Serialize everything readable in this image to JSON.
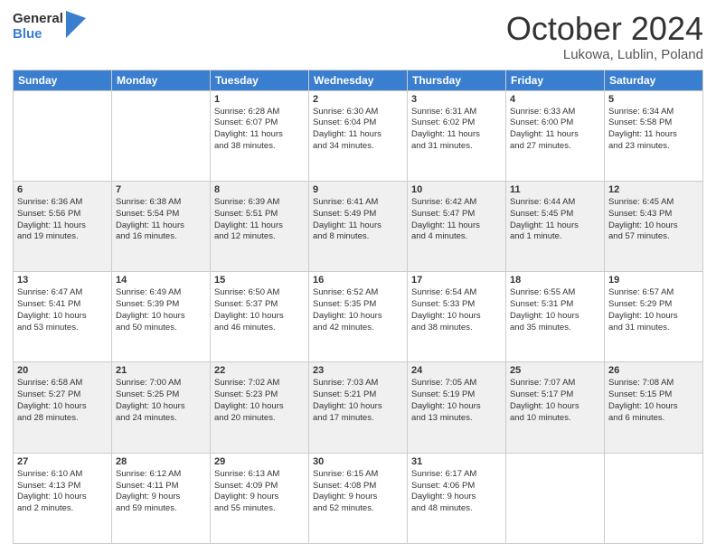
{
  "logo": {
    "general": "General",
    "blue": "Blue"
  },
  "title": "October 2024",
  "subtitle": "Lukowa, Lublin, Poland",
  "days_of_week": [
    "Sunday",
    "Monday",
    "Tuesday",
    "Wednesday",
    "Thursday",
    "Friday",
    "Saturday"
  ],
  "weeks": [
    [
      {
        "day": "",
        "lines": []
      },
      {
        "day": "",
        "lines": []
      },
      {
        "day": "1",
        "lines": [
          "Sunrise: 6:28 AM",
          "Sunset: 6:07 PM",
          "Daylight: 11 hours",
          "and 38 minutes."
        ]
      },
      {
        "day": "2",
        "lines": [
          "Sunrise: 6:30 AM",
          "Sunset: 6:04 PM",
          "Daylight: 11 hours",
          "and 34 minutes."
        ]
      },
      {
        "day": "3",
        "lines": [
          "Sunrise: 6:31 AM",
          "Sunset: 6:02 PM",
          "Daylight: 11 hours",
          "and 31 minutes."
        ]
      },
      {
        "day": "4",
        "lines": [
          "Sunrise: 6:33 AM",
          "Sunset: 6:00 PM",
          "Daylight: 11 hours",
          "and 27 minutes."
        ]
      },
      {
        "day": "5",
        "lines": [
          "Sunrise: 6:34 AM",
          "Sunset: 5:58 PM",
          "Daylight: 11 hours",
          "and 23 minutes."
        ]
      }
    ],
    [
      {
        "day": "6",
        "lines": [
          "Sunrise: 6:36 AM",
          "Sunset: 5:56 PM",
          "Daylight: 11 hours",
          "and 19 minutes."
        ]
      },
      {
        "day": "7",
        "lines": [
          "Sunrise: 6:38 AM",
          "Sunset: 5:54 PM",
          "Daylight: 11 hours",
          "and 16 minutes."
        ]
      },
      {
        "day": "8",
        "lines": [
          "Sunrise: 6:39 AM",
          "Sunset: 5:51 PM",
          "Daylight: 11 hours",
          "and 12 minutes."
        ]
      },
      {
        "day": "9",
        "lines": [
          "Sunrise: 6:41 AM",
          "Sunset: 5:49 PM",
          "Daylight: 11 hours",
          "and 8 minutes."
        ]
      },
      {
        "day": "10",
        "lines": [
          "Sunrise: 6:42 AM",
          "Sunset: 5:47 PM",
          "Daylight: 11 hours",
          "and 4 minutes."
        ]
      },
      {
        "day": "11",
        "lines": [
          "Sunrise: 6:44 AM",
          "Sunset: 5:45 PM",
          "Daylight: 11 hours",
          "and 1 minute."
        ]
      },
      {
        "day": "12",
        "lines": [
          "Sunrise: 6:45 AM",
          "Sunset: 5:43 PM",
          "Daylight: 10 hours",
          "and 57 minutes."
        ]
      }
    ],
    [
      {
        "day": "13",
        "lines": [
          "Sunrise: 6:47 AM",
          "Sunset: 5:41 PM",
          "Daylight: 10 hours",
          "and 53 minutes."
        ]
      },
      {
        "day": "14",
        "lines": [
          "Sunrise: 6:49 AM",
          "Sunset: 5:39 PM",
          "Daylight: 10 hours",
          "and 50 minutes."
        ]
      },
      {
        "day": "15",
        "lines": [
          "Sunrise: 6:50 AM",
          "Sunset: 5:37 PM",
          "Daylight: 10 hours",
          "and 46 minutes."
        ]
      },
      {
        "day": "16",
        "lines": [
          "Sunrise: 6:52 AM",
          "Sunset: 5:35 PM",
          "Daylight: 10 hours",
          "and 42 minutes."
        ]
      },
      {
        "day": "17",
        "lines": [
          "Sunrise: 6:54 AM",
          "Sunset: 5:33 PM",
          "Daylight: 10 hours",
          "and 38 minutes."
        ]
      },
      {
        "day": "18",
        "lines": [
          "Sunrise: 6:55 AM",
          "Sunset: 5:31 PM",
          "Daylight: 10 hours",
          "and 35 minutes."
        ]
      },
      {
        "day": "19",
        "lines": [
          "Sunrise: 6:57 AM",
          "Sunset: 5:29 PM",
          "Daylight: 10 hours",
          "and 31 minutes."
        ]
      }
    ],
    [
      {
        "day": "20",
        "lines": [
          "Sunrise: 6:58 AM",
          "Sunset: 5:27 PM",
          "Daylight: 10 hours",
          "and 28 minutes."
        ]
      },
      {
        "day": "21",
        "lines": [
          "Sunrise: 7:00 AM",
          "Sunset: 5:25 PM",
          "Daylight: 10 hours",
          "and 24 minutes."
        ]
      },
      {
        "day": "22",
        "lines": [
          "Sunrise: 7:02 AM",
          "Sunset: 5:23 PM",
          "Daylight: 10 hours",
          "and 20 minutes."
        ]
      },
      {
        "day": "23",
        "lines": [
          "Sunrise: 7:03 AM",
          "Sunset: 5:21 PM",
          "Daylight: 10 hours",
          "and 17 minutes."
        ]
      },
      {
        "day": "24",
        "lines": [
          "Sunrise: 7:05 AM",
          "Sunset: 5:19 PM",
          "Daylight: 10 hours",
          "and 13 minutes."
        ]
      },
      {
        "day": "25",
        "lines": [
          "Sunrise: 7:07 AM",
          "Sunset: 5:17 PM",
          "Daylight: 10 hours",
          "and 10 minutes."
        ]
      },
      {
        "day": "26",
        "lines": [
          "Sunrise: 7:08 AM",
          "Sunset: 5:15 PM",
          "Daylight: 10 hours",
          "and 6 minutes."
        ]
      }
    ],
    [
      {
        "day": "27",
        "lines": [
          "Sunrise: 6:10 AM",
          "Sunset: 4:13 PM",
          "Daylight: 10 hours",
          "and 2 minutes."
        ]
      },
      {
        "day": "28",
        "lines": [
          "Sunrise: 6:12 AM",
          "Sunset: 4:11 PM",
          "Daylight: 9 hours",
          "and 59 minutes."
        ]
      },
      {
        "day": "29",
        "lines": [
          "Sunrise: 6:13 AM",
          "Sunset: 4:09 PM",
          "Daylight: 9 hours",
          "and 55 minutes."
        ]
      },
      {
        "day": "30",
        "lines": [
          "Sunrise: 6:15 AM",
          "Sunset: 4:08 PM",
          "Daylight: 9 hours",
          "and 52 minutes."
        ]
      },
      {
        "day": "31",
        "lines": [
          "Sunrise: 6:17 AM",
          "Sunset: 4:06 PM",
          "Daylight: 9 hours",
          "and 48 minutes."
        ]
      },
      {
        "day": "",
        "lines": []
      },
      {
        "day": "",
        "lines": []
      }
    ]
  ]
}
